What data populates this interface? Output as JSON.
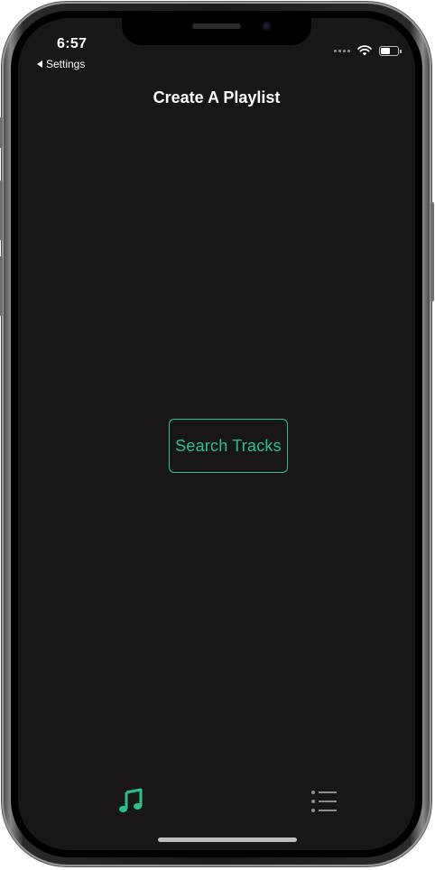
{
  "status_bar": {
    "time": "6:57",
    "back_label": "Settings",
    "battery_level": 0.6
  },
  "nav": {
    "title": "Create A Playlist"
  },
  "main": {
    "search_button_label": "Search Tracks"
  },
  "tab_bar": {
    "items": [
      {
        "icon": "music-note-icon",
        "active": true
      },
      {
        "icon": "list-icon",
        "active": false
      }
    ]
  },
  "colors": {
    "accent": "#24c48a",
    "background": "#181616",
    "inactive_icon": "#8e8e8e"
  }
}
